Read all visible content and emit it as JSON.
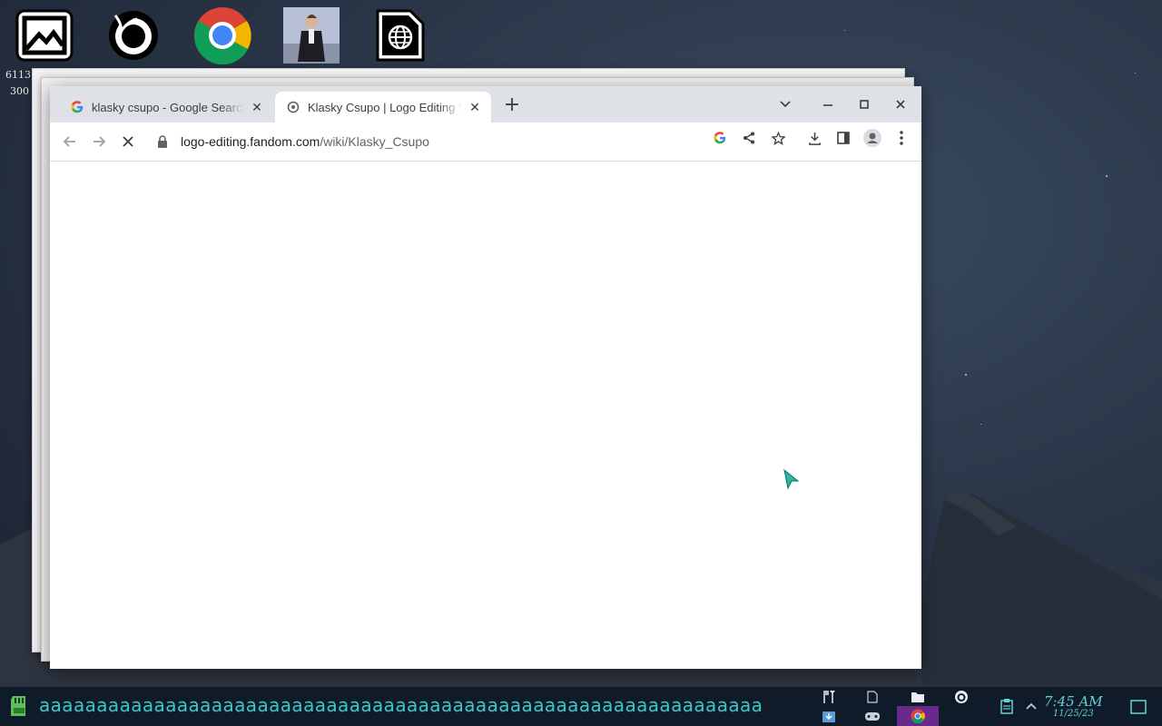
{
  "desktop": {
    "icons": [
      {
        "name": "image-viewer"
      },
      {
        "name": "firefox"
      },
      {
        "name": "chrome"
      },
      {
        "name": "rick-photo"
      },
      {
        "name": "web-document"
      }
    ],
    "partial_labels": [
      "6113",
      "300"
    ]
  },
  "browser": {
    "tabs": [
      {
        "title": "klasky csupo - Google Search",
        "favicon": "google-icon",
        "active": false
      },
      {
        "title": "Klasky Csupo | Logo Editing Wiki",
        "favicon": "fandom-icon",
        "active": true
      }
    ],
    "new_tab_label": "+",
    "url_domain": "logo-editing.fandom.com",
    "url_path": "/wiki/Klasky_Csupo",
    "loading": true
  },
  "taskbar": {
    "marquee_text": "aaaaaaaaaaaaaaaaaaaaaaaaaaaaaaaaaaaaaaaaaaaaaaaaaaaaaaaaaaaaaaa",
    "time": "7:45 AM",
    "date": "11/25/23"
  },
  "colors": {
    "accent": "#3fc7c7",
    "taskbar_bg": "#101b2a",
    "tabstrip_bg": "#dee1e6"
  }
}
